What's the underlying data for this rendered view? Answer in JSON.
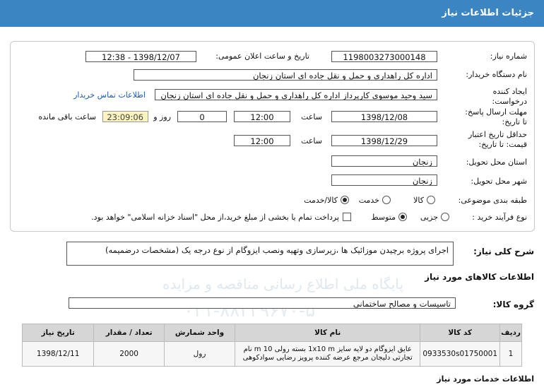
{
  "header": {
    "title": "جزئیات اطلاعات نیاز"
  },
  "form": {
    "need_number_label": "شماره نیاز:",
    "need_number": "1198003273000148",
    "announce_label": "تاریخ و ساعت اعلان عمومی:",
    "announce_value": "1398/12/07 - 12:38",
    "buyer_label": "نام دستگاه خریدار:",
    "buyer_value": "اداره کل راهداری و حمل و نقل جاده ای استان زنجان",
    "creator_label_1": "ایجاد کننده",
    "creator_label_2": "درخواست:",
    "creator_value": "سید وحید موسوی کارپرداز اداره کل راهداری و حمل و نقل جاده ای استان زنجان",
    "contact_link": "اطلاعات تماس خریدار",
    "deadline_label_1": "مهلت ارسال پاسخ:",
    "deadline_label_2": "تا تاریخ:",
    "deadline_date": "1398/12/08",
    "time_label": "ساعت",
    "deadline_time": "12:00",
    "days_value": "0",
    "days_label": "روز و",
    "remaining_time": "23:09:06",
    "remaining_label": "ساعت باقی مانده",
    "validity_label_1": "حداقل تاریخ اعتبار",
    "validity_label_2": "قیمت: تا تاریخ:",
    "validity_date": "1398/12/29",
    "validity_time": "12:00",
    "province_label": "استان محل تحویل:",
    "province_value": "زنجان",
    "city_label": "شهر محل تحویل:",
    "city_value": "زنجان",
    "category_label": "طبقه بندی موضوعی:",
    "category_options": [
      "کالا",
      "خدمت",
      "کالا/خدمت"
    ],
    "category_selected": "کالا/خدمت",
    "process_label": "نوع فرآیند خرید :",
    "process_options": [
      "جزیی",
      "متوسط"
    ],
    "process_selected": "متوسط",
    "payment_note": "پرداخت تمام یا بخشی از مبلغ خرید،از محل \"اسناد خزانه اسلامی\" خواهد بود."
  },
  "summary": {
    "label": "شرح کلی نیاز:",
    "value": "اجرای پروژه برچیدن موزائیک ها ،زیرسازی وتهیه ونصب ایزوگام از نوع درجه یک (مشخصات درضمیمه)"
  },
  "goods_section_title": "اطلاعات کالاهای مورد نیاز",
  "goods_group": {
    "label": "گروه کالا:",
    "value": "تاسیسات و مصالح ساختمانی"
  },
  "goods_table": {
    "headers": [
      "ردیف",
      "کد کالا",
      "نام کالا",
      "واحد شمارش",
      "تعداد / مقدار",
      "تاریخ نیاز"
    ],
    "rows": [
      {
        "row": "1",
        "code": "0933530s01750001",
        "name": "عایق ایزوگام دو لایه سایز 1x10 m بسته رولی 10 m نام تجارتی دلیجان مرجع عرضه کننده پرویز رضایی سوادکوهی",
        "unit": "رول",
        "qty": "2000",
        "date": "1398/12/11"
      }
    ]
  },
  "services_section_title": "اطلاعات خدمات مورد نیاز",
  "watermark": {
    "line1": "پایگاه ملی اطلاع رسانی مناقصه و مزایده",
    "line2": "۰۲۱-۸۸۳۴۹۶۷۰-۵"
  }
}
